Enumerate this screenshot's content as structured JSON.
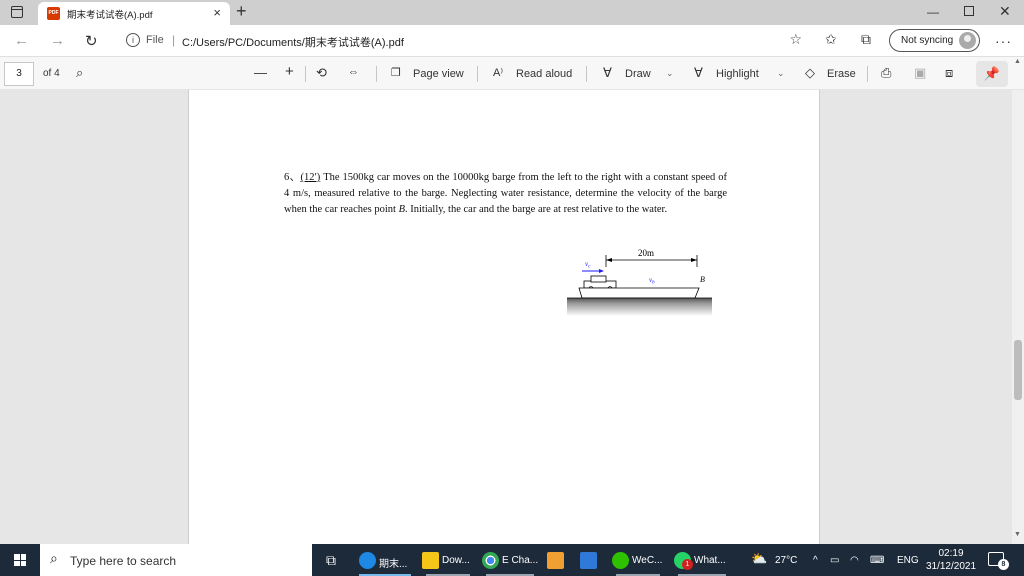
{
  "browser": {
    "tab_title": "期末考试试卷(A).pdf",
    "tab_icon_text": "PDF",
    "address": {
      "scheme_label": "File",
      "url": "C:/Users/PC/Documents/期末考试试卷(A).pdf"
    },
    "sync_label": "Not syncing"
  },
  "pdf_toolbar": {
    "current_page": "3",
    "page_of": "of 4",
    "page_view": "Page view",
    "read_aloud": "Read aloud",
    "draw": "Draw",
    "highlight": "Highlight",
    "erase": "Erase"
  },
  "document": {
    "problem": {
      "number": "6、",
      "points": "(12′)",
      "text_before_B": " The 1500kg car moves on the 10000kg barge from the left to the right with a constant speed of 4 m/s, measured relative to the barge. Neglecting water resistance, determine the velocity of the barge when the car reaches point ",
      "point_label": "B",
      "text_after_B": ". Initially, the car and the barge are at rest relative to the water."
    },
    "figure": {
      "distance_label": "20m",
      "car_velocity_label": "v",
      "car_velocity_sub": "c",
      "barge_velocity_label": "v",
      "barge_velocity_sub": "b",
      "point_label": "B",
      "arrow_color": "#1a1aff"
    }
  },
  "taskbar": {
    "search_placeholder": "Type here to search",
    "apps": [
      {
        "label": "期末...",
        "color": "#1e88e5"
      },
      {
        "label": "Dow...",
        "color": "#f5c518"
      },
      {
        "label": "E Cha...",
        "color": "#34a853"
      },
      {
        "label": "",
        "color": "#f0a030"
      },
      {
        "label": "",
        "color": "#2f7ad8"
      },
      {
        "label": "WeC...",
        "color": "#2dc100"
      },
      {
        "label": "What...",
        "color": "#25d366",
        "badge": "1"
      }
    ],
    "weather": "27°C",
    "language": "ENG",
    "time": "02:19",
    "date": "31/12/2021",
    "notification_count": "8"
  }
}
